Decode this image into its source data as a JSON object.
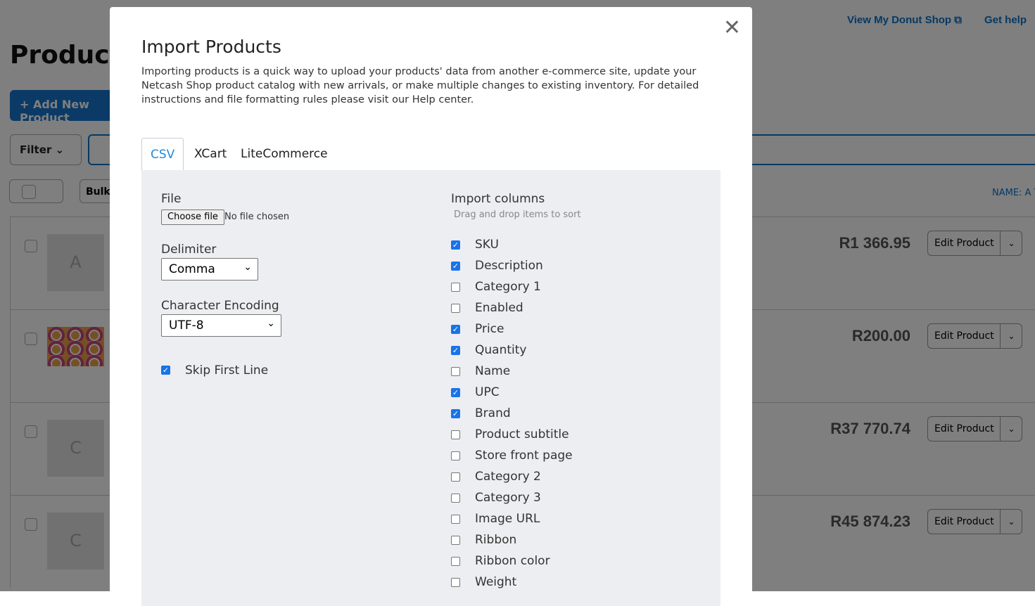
{
  "header": {
    "view_shop": "View My Donut Shop",
    "get_help": "Get help"
  },
  "page": {
    "title": "Products",
    "add_button": "+ Add New Product",
    "filter": "Filter",
    "bulk": "Bulk",
    "sort_label": "NAME: A T"
  },
  "products": [
    {
      "thumb": "A",
      "price": "R1 366.95",
      "edit": "Edit Product"
    },
    {
      "thumb": "",
      "price": "R200.00",
      "edit": "Edit Product"
    },
    {
      "thumb": "C",
      "price": "R37 770.74",
      "edit": "Edit Product"
    },
    {
      "thumb": "C",
      "price": "R45 874.23",
      "edit": "Edit Product"
    }
  ],
  "modal": {
    "title": "Import Products",
    "description": "Importing products is a quick way to upload your products' data from another e-commerce site, update your Netcash Shop product catalog with new arrivals, or make multiple changes to existing inventory. For detailed instructions and file formatting rules please visit our Help center.",
    "tabs": [
      "CSV",
      "XCart",
      "LiteCommerce"
    ],
    "active_tab": "CSV",
    "file_label": "File",
    "choose_file": "Choose file",
    "no_file": "No file chosen",
    "delimiter_label": "Delimiter",
    "delimiter_value": "Comma",
    "encoding_label": "Character Encoding",
    "encoding_value": "UTF-8",
    "skip_first_line": "Skip First Line",
    "skip_first_line_checked": true,
    "columns_label": "Import columns",
    "columns_hint": "Drag and drop items to sort",
    "columns": [
      {
        "label": "SKU",
        "checked": true
      },
      {
        "label": "Description",
        "checked": true
      },
      {
        "label": "Category 1",
        "checked": false
      },
      {
        "label": "Enabled",
        "checked": false
      },
      {
        "label": "Price",
        "checked": true
      },
      {
        "label": "Quantity",
        "checked": true
      },
      {
        "label": "Name",
        "checked": false
      },
      {
        "label": "UPC",
        "checked": true
      },
      {
        "label": "Brand",
        "checked": true
      },
      {
        "label": "Product subtitle",
        "checked": false
      },
      {
        "label": "Store front page",
        "checked": false
      },
      {
        "label": "Category 2",
        "checked": false
      },
      {
        "label": "Category 3",
        "checked": false
      },
      {
        "label": "Image URL",
        "checked": false
      },
      {
        "label": "Ribbon",
        "checked": false
      },
      {
        "label": "Ribbon color",
        "checked": false
      },
      {
        "label": "Weight",
        "checked": false
      }
    ]
  }
}
